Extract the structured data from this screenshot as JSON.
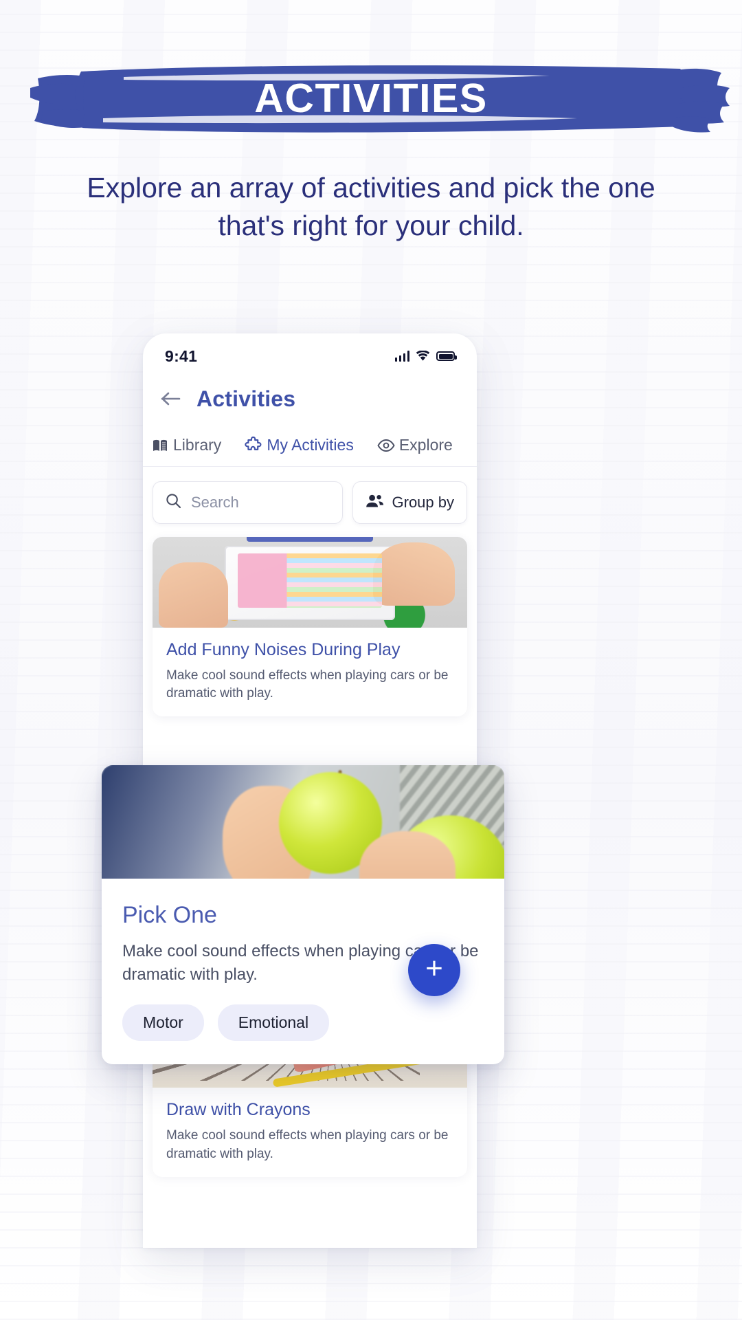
{
  "promo": {
    "banner_title": "ACTIVITIES",
    "subtitle": "Explore an array of activities and pick the one that's right for your child.",
    "banner_color": "#3f51a8",
    "subtitle_color": "#2a2f7a"
  },
  "phone": {
    "status": {
      "time": "9:41",
      "signal_icon": "cellular-signal-icon",
      "wifi_icon": "wifi-icon",
      "battery_icon": "battery-full-icon"
    },
    "appbar": {
      "back_icon": "arrow-left-icon",
      "title": "Activities"
    },
    "tabs": [
      {
        "label": "Library",
        "icon": "book-icon",
        "active": false
      },
      {
        "label": "My Activities",
        "icon": "puzzle-piece-icon",
        "active": true
      },
      {
        "label": "Explore",
        "icon": "eye-icon",
        "active": false
      }
    ],
    "search": {
      "icon": "search-icon",
      "placeholder": "Search",
      "value": ""
    },
    "group_by": {
      "icon": "people-icon",
      "label": "Group by"
    },
    "cards": [
      {
        "title": "Add Funny Noises During Play",
        "description": "Make cool sound effects when playing cars or be dramatic with play."
      },
      {
        "title": "Draw with Crayons",
        "description": "Make cool sound effects when playing cars or be dramatic with play."
      }
    ],
    "featured_card": {
      "title": "Pick One",
      "description": "Make cool sound effects when playing cars or be dramatic with play.",
      "tags": [
        "Motor",
        "Emotional"
      ]
    },
    "fab": {
      "label": "+",
      "icon": "plus-icon",
      "color": "#2d49c9"
    }
  }
}
